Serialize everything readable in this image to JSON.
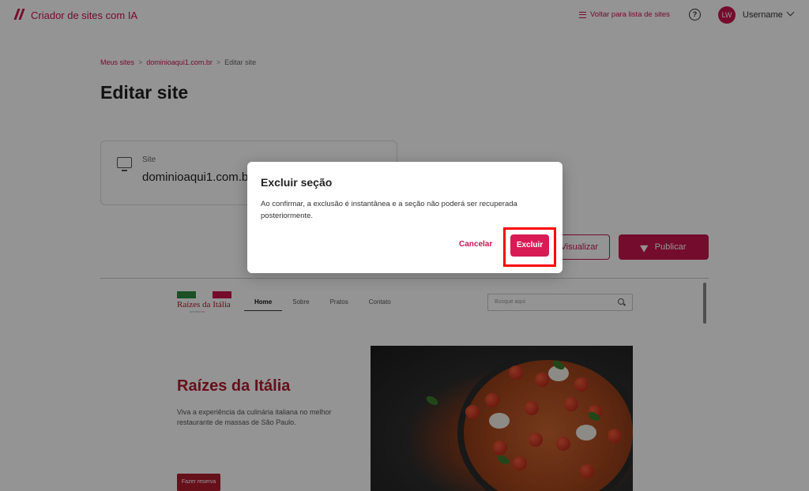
{
  "app": {
    "title": "Criador de sites com IA",
    "back_link": "Voltar para lista de sites",
    "help_icon": "help-circle-icon",
    "avatar_initials": "LW",
    "username": "Username"
  },
  "breadcrumb": {
    "items": [
      "Meus sites",
      "dominioaqui1.com.br",
      "Editar site"
    ],
    "separator": ">"
  },
  "page": {
    "title": "Editar site"
  },
  "site_card": {
    "label": "Site",
    "value": "dominioaqui1.com.b"
  },
  "actions": {
    "visualizar": "Visualizar",
    "publicar": "Publicar"
  },
  "preview": {
    "logo_text": "Raízes da Itália",
    "logo_sub": "RISTORANTE",
    "nav": [
      "Home",
      "Sobre",
      "Pratos",
      "Contato"
    ],
    "search_placeholder": "Busque aqui",
    "hero_title": "Raízes da Itália",
    "hero_text": "Viva a experiência da culinária italiana no melhor restaurante de massas de São Paulo.",
    "hero_button": "Fazer reserva"
  },
  "modal": {
    "title": "Excluir seção",
    "body": "Ao confirmar, a exclusão é instantânea e a seção não poderá ser recuperada posteriormente.",
    "cancel": "Cancelar",
    "confirm": "Excluir"
  },
  "colors": {
    "brand": "#c8164f",
    "highlight": "#ff0000"
  }
}
